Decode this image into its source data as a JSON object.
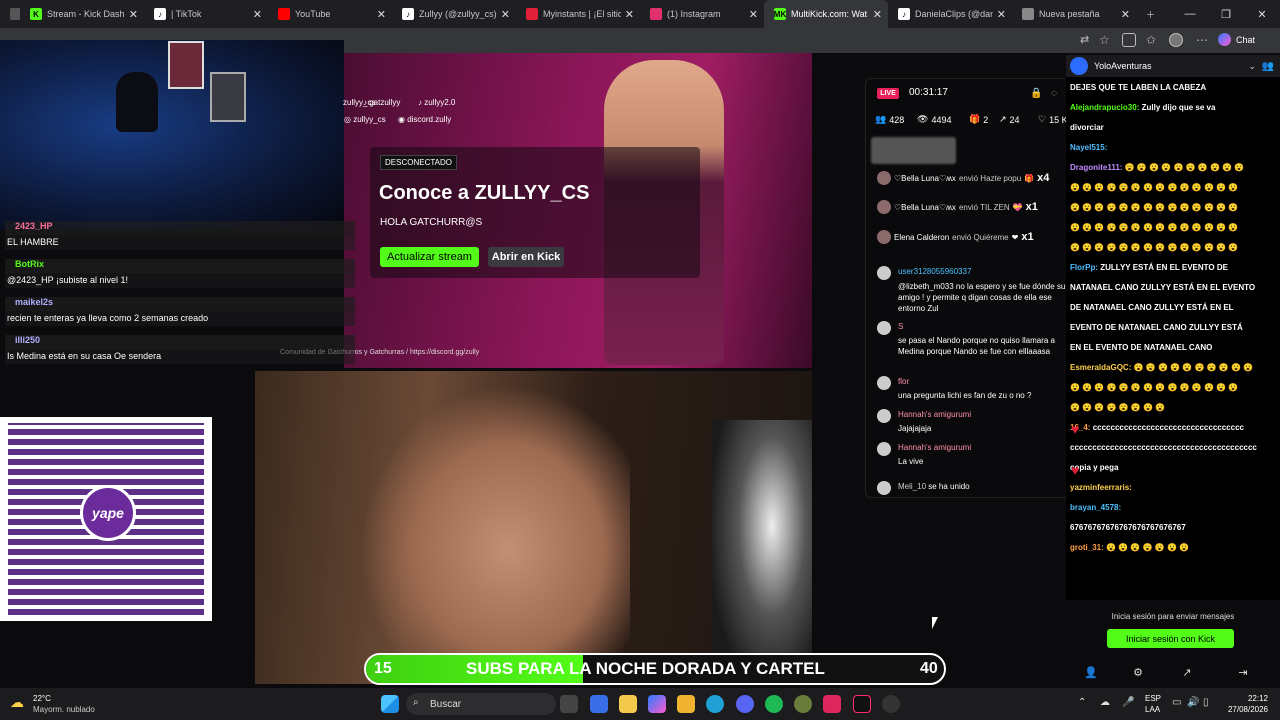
{
  "browser": {
    "tabs": [
      {
        "label": "Stream - Kick Dashboard",
        "icon": "kick-icon",
        "color": "#53fc18"
      },
      {
        "label": "| TikTok",
        "icon": "tiktok-icon",
        "color": "#ffffff"
      },
      {
        "label": "YouTube",
        "icon": "youtube-icon",
        "color": "#ff0000"
      },
      {
        "label": "Zullyy (@zullyy_cs) | Tik",
        "icon": "tiktok-icon",
        "color": "#ffffff"
      },
      {
        "label": "Myinstants | ¡El sitio web",
        "icon": "myinstants-icon",
        "color": "#e02038"
      },
      {
        "label": "(1) Instagram",
        "icon": "instagram-icon",
        "color": "#e1306c"
      },
      {
        "label": "MultiKick.com: Wat",
        "icon": "multikick-icon",
        "color": "#53fc18",
        "active": true
      },
      {
        "label": "DanielaClips (@daniela",
        "icon": "tiktok-icon",
        "color": "#ffffff"
      },
      {
        "label": "Nueva pestaña",
        "icon": "newtab-icon",
        "color": "#cccccc"
      }
    ],
    "chat_button": "Chat"
  },
  "left_chat": {
    "messages": [
      {
        "user": "2423_HP",
        "text": "EL HAMBRE",
        "user_color": "#ff6f9a"
      },
      {
        "user": "BotRix",
        "text": "@2423_HP ¡subiste al nivel 1!",
        "user_color": "#53fc18"
      },
      {
        "user": "maikel2s",
        "text": "recien te enteras ya lleva como 2 semanas creado",
        "user_color": "#b0b0ff"
      },
      {
        "user": "illi250",
        "text": "Is Medina está en su casa Oe sendera",
        "user_color": "#b0b0ff"
      }
    ]
  },
  "qr": {
    "logo": "yape"
  },
  "offline": {
    "socials": [
      "zullyy_cs",
      "gatzullyy",
      "zullyy2.0",
      "zullyy_cs",
      "discord.zully"
    ],
    "badge": "DESCONECTADO",
    "title": "Conoce a ZULLYY_CS",
    "subtitle": "HOLA GATCHURR@S",
    "update_button": "Actualizar stream",
    "open_button": "Abrir en Kick",
    "community": "Comunidad de Gatchurros y Gatchurras  /  https://discord.gg/zully"
  },
  "popup": {
    "live": "LIVE",
    "timer": "00:31:17",
    "stats": {
      "viewers": "428",
      "views": "4494",
      "gifts": "2",
      "shares": "24",
      "likes": "15 K"
    },
    "gifts": [
      {
        "user": "♡Bella Luna♡ʍx",
        "action": "envió Hazte popu",
        "count": "x4"
      },
      {
        "user": "♡Bella Luna♡ʍx",
        "action": "envió TIL ZEN",
        "count": "x1"
      },
      {
        "user": "Elena Calderon",
        "action": "envió Quiéreme",
        "count": "x1"
      }
    ],
    "messages": [
      {
        "user": "user3128055960337",
        "text": "@lizbeth_m033 no la espero y se fue dónde su amigo ! y permite q digan cosas de ella ese entorno Zul"
      },
      {
        "user": "S",
        "text": "se pasa el Nando porque no quiso llamara a Medina porque Nando se fue con elllaaasa"
      },
      {
        "user": "flor",
        "text": "una pregunta lichi es fan de zu o no ?"
      },
      {
        "user": "Hannah's amigurumi",
        "text": "Jajajajaja"
      },
      {
        "user": "Hannah's amigurumi",
        "text": "La vive"
      },
      {
        "user": "Meli_10",
        "text": "se ha unido"
      }
    ]
  },
  "right_chat": {
    "channel": "YoloAventuras",
    "lines": [
      {
        "user": "",
        "text": "DEJES QUE TE LABEN LA CABEZA"
      },
      {
        "user": "Alejandrapucio30:",
        "text": "Zully dijo que se va"
      },
      {
        "user": "",
        "text": "divorciar"
      },
      {
        "user": "Nayel515:",
        "text": ""
      },
      {
        "user": "Dragonite111:",
        "text": "😮 😮 😮 😮 😮 😮 😮 😮 😮 😮"
      },
      {
        "user": "",
        "text": "😮 😮 😮 😮 😮 😮 😮 😮 😮 😮 😮 😮 😮 😮"
      },
      {
        "user": "",
        "text": "😮 😮 😮 😮 😮 😮 😮 😮 😮 😮 😮 😮 😮 😮"
      },
      {
        "user": "",
        "text": "😮 😮 😮 😮 😮 😮 😮 😮 😮 😮 😮 😮 😮 😮"
      },
      {
        "user": "",
        "text": "😮 😮 😮 😮 😮 😮 😮 😮 😮 😮 😮 😮 😮 😮"
      },
      {
        "user": "FlorPp:",
        "text": "ZULLYY ESTÁ EN EL EVENTO DE"
      },
      {
        "user": "",
        "text": "NATANAEL CANO ZULLYY ESTÁ EN EL EVENTO"
      },
      {
        "user": "",
        "text": "DE NATANAEL CANO ZULLYY ESTÁ EN EL"
      },
      {
        "user": "",
        "text": "EVENTO DE NATANAEL CANO ZULLYY ESTÁ"
      },
      {
        "user": "",
        "text": "EN EL EVENTO DE NATANAEL CANO"
      },
      {
        "user": "EsmeraldaGQC:",
        "text": "😮 😮 😮 😮 😮 😮 😮 😮 😮 😮"
      },
      {
        "user": "",
        "text": "😮 😮 😮 😮 😮 😮 😮 😮 😮 😮 😮 😮 😮 😮"
      },
      {
        "user": "",
        "text": "😮 😮 😮 😮 😮 😮 😮 😮"
      },
      {
        "user": "16_4:",
        "text": "cccccccccccccccccccccccccccccccccc"
      },
      {
        "user": "",
        "text": "cccccccccccccccccccccccccccccccccccccccccc"
      },
      {
        "user": "",
        "text": "copia y pega"
      },
      {
        "user": "yazminfeerraris:",
        "text": ""
      },
      {
        "user": "brayan_4578:",
        "text": ""
      },
      {
        "user": "",
        "text": "67676767676767676767676767"
      },
      {
        "user": "groti_31:",
        "text": "😮 😮 😮 😮 😮 😮 😮"
      }
    ],
    "login_hint": "Inicia sesión para enviar mensajes",
    "login_button": "Iniciar sesión con Kick"
  },
  "subs_goal": {
    "current": "15",
    "label": "SUBS PARA LA NOCHE DORADA Y CARTEL",
    "target": "40",
    "progress": 0.375,
    "color": "#53fc18"
  },
  "taskbar": {
    "weather_temp": "22°C",
    "weather_desc": "Mayorm. nublado",
    "search": "Buscar",
    "lang": "ESP",
    "lang2": "LAA",
    "time": "22:12",
    "date": "27/08/2026"
  }
}
